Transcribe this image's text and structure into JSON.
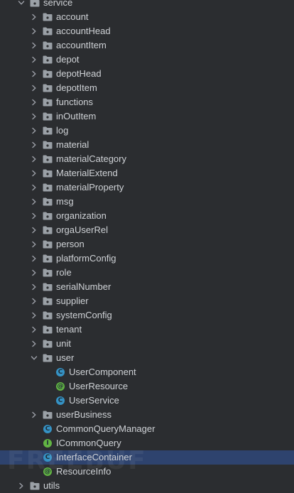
{
  "tree": {
    "root": {
      "label": "service",
      "expanded": true
    },
    "packages_before_user": [
      "account",
      "accountHead",
      "accountItem",
      "depot",
      "depotHead",
      "depotItem",
      "functions",
      "inOutItem",
      "log",
      "material",
      "materialCategory",
      "MaterialExtend",
      "materialProperty",
      "msg",
      "organization",
      "orgaUserRel",
      "person",
      "platformConfig",
      "role",
      "serialNumber",
      "supplier",
      "systemConfig",
      "tenant",
      "unit"
    ],
    "user_package": {
      "label": "user",
      "expanded": true,
      "children": [
        {
          "label": "UserComponent",
          "kind": "class"
        },
        {
          "label": "UserResource",
          "kind": "annotation"
        },
        {
          "label": "UserService",
          "kind": "class"
        }
      ]
    },
    "user_business": {
      "label": "userBusiness"
    },
    "files": [
      {
        "label": "CommonQueryManager",
        "kind": "class"
      },
      {
        "label": "ICommonQuery",
        "kind": "interface"
      },
      {
        "label": "InterfaceContainer",
        "kind": "class",
        "selected": true
      },
      {
        "label": "ResourceInfo",
        "kind": "annotation"
      }
    ],
    "partial_last": {
      "label": "utils"
    }
  },
  "colors": {
    "background": "#2b2d30",
    "selection": "#2e436e",
    "class_icon": "#3592c4",
    "interface_icon": "#62b543",
    "folder_icon": "#9aa0a6"
  },
  "icons": {
    "expanded": "chevron-down-icon",
    "collapsed": "chevron-right-icon",
    "package": "package-folder-icon"
  },
  "watermark": "FREEBUF"
}
